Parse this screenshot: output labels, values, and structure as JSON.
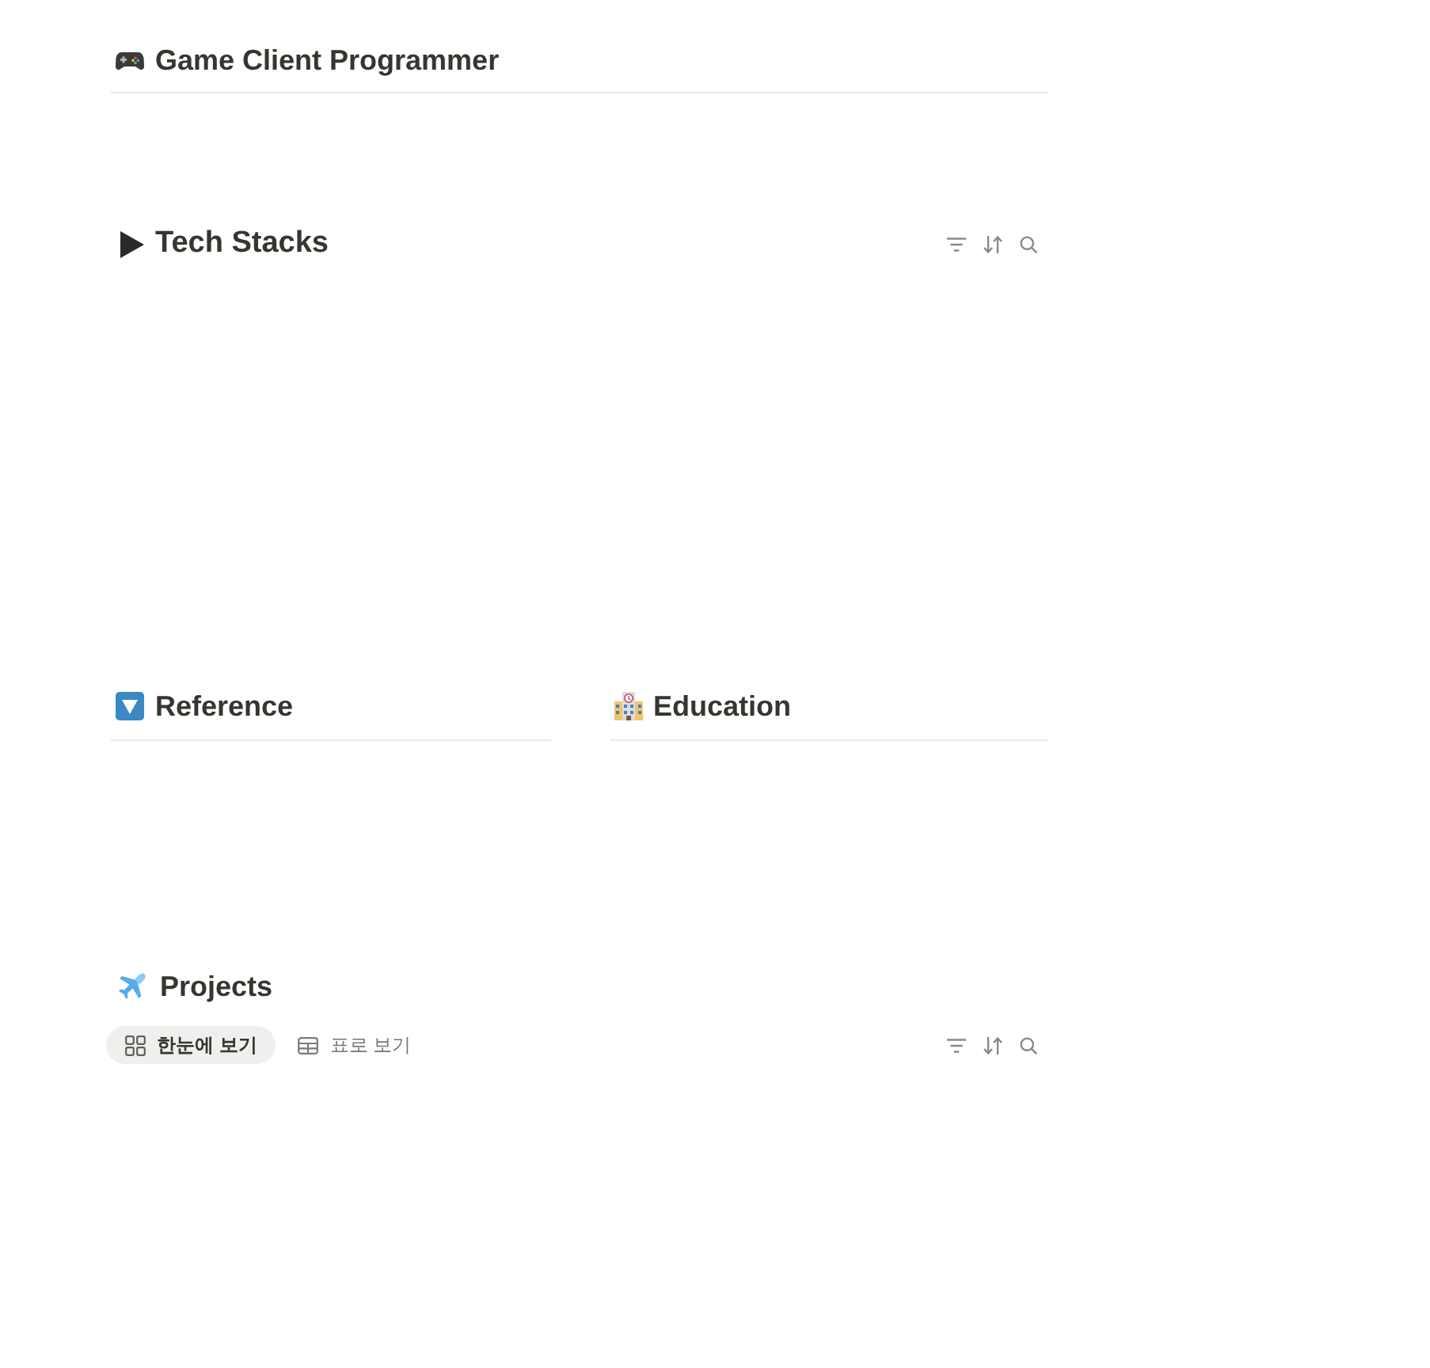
{
  "header": {
    "title": "Game Client Programmer"
  },
  "tech_stacks": {
    "title": "Tech Stacks",
    "expanded": false
  },
  "columns": [
    {
      "title": "Reference",
      "kind": "reference"
    },
    {
      "title": "Education",
      "kind": "education"
    }
  ],
  "projects": {
    "title": "Projects",
    "views": [
      {
        "label": "한눈에 보기",
        "kind": "gallery",
        "selected": true
      },
      {
        "label": "표로 보기",
        "kind": "table",
        "selected": false
      }
    ]
  }
}
